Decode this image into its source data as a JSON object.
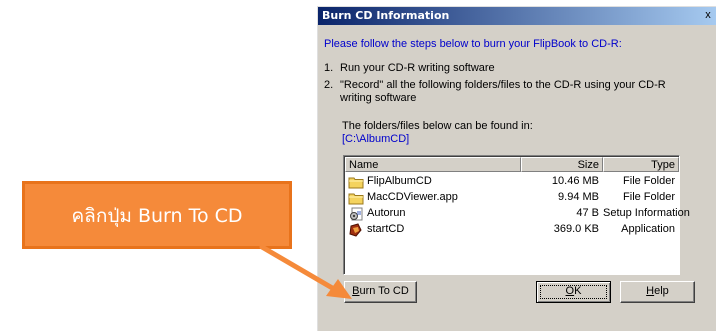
{
  "dialog": {
    "title": "Burn CD Information",
    "close_glyph": "x",
    "intro": "Please follow the steps below to burn your FlipBook to CD-R:",
    "steps": [
      {
        "num": "1.",
        "text": "Run your CD-R writing software"
      },
      {
        "num": "2.",
        "text": "\"Record\" all the following folders/files to the CD-R using your CD-R writing software"
      }
    ],
    "found_label": "The folders/files below can be found in:",
    "found_path": "[C:\\AlbumCD]",
    "columns": {
      "name": "Name",
      "size": "Size",
      "type": "Type"
    },
    "files": [
      {
        "name": "FlipAlbumCD",
        "size": "10.46 MB",
        "type": "File Folder",
        "icon": "folder-icon"
      },
      {
        "name": "MacCDViewer.app",
        "size": "9.94 MB",
        "type": "File Folder",
        "icon": "folder-icon"
      },
      {
        "name": "Autorun",
        "size": "47 B",
        "type": "Setup Information",
        "icon": "setup-file-icon"
      },
      {
        "name": "startCD",
        "size": "369.0 KB",
        "type": "Application",
        "icon": "application-icon"
      }
    ],
    "buttons": {
      "burn": {
        "mnemonic": "B",
        "rest": "urn To CD"
      },
      "ok": {
        "mnemonic": "O",
        "rest": "K"
      },
      "help": {
        "mnemonic": "H",
        "rest": "elp"
      }
    }
  },
  "annotation": {
    "text": "คลิกปุ่ม Burn To CD",
    "color": "#f58a3a"
  },
  "colors": {
    "titlebar": "#0a246a",
    "face": "#d4d0c8",
    "link_blue": "#0000cc",
    "folder": "#f4d35e"
  }
}
